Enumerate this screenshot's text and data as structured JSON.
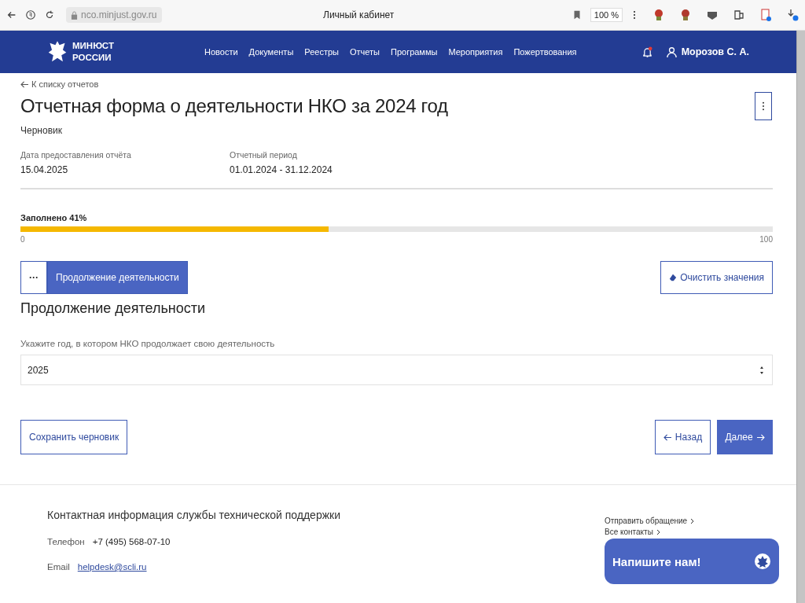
{
  "browser": {
    "address": "nco.minjust.gov.ru",
    "title": "Личный кабинет",
    "zoom": "100 %"
  },
  "header": {
    "logo": [
      "МИНЮСТ",
      "РОССИИ"
    ],
    "nav": [
      "Новости",
      "Документы",
      "Реестры",
      "Отчеты",
      "Программы",
      "Мероприятия",
      "Пожертвования"
    ],
    "notifications": true,
    "user": "Морозов С. А."
  },
  "back_link": "К списку отчетов",
  "title": "Отчетная форма о деятельности НКО за 2024 год",
  "status": "Черновик",
  "meta": [
    {
      "label": "Дата предоставления отчёта",
      "value": "15.04.2025"
    },
    {
      "label": "Отчетный период",
      "value": "01.01.2024 - 31.12.2024"
    }
  ],
  "progress": {
    "label": "Заполнено 41%",
    "level": 0.41,
    "min": "0",
    "max": "100"
  },
  "section_tabs": [
    {
      "label": "···",
      "selected": false
    },
    {
      "label": "Продолжение деятельности",
      "selected": true
    }
  ],
  "clear_button": "Очистить значения",
  "section_title": "Продолжение деятельности",
  "field": {
    "label": "Укажите год, в котором НКО продолжает свою деятельность",
    "value": "2025"
  },
  "buttons": {
    "save": "Сохранить черновик",
    "back": "Назад",
    "next": "Далее"
  },
  "footer": {
    "title": "Контактная информация службы технической поддержки",
    "phone_label": "Телефон",
    "phone": "+7 (495) 568-07-10",
    "email_label": "Email",
    "email": "helpdesk@scli.ru",
    "links": [
      "Отправить обращение",
      "Все контакты"
    ]
  },
  "chat_button": "Напишите нам!"
}
